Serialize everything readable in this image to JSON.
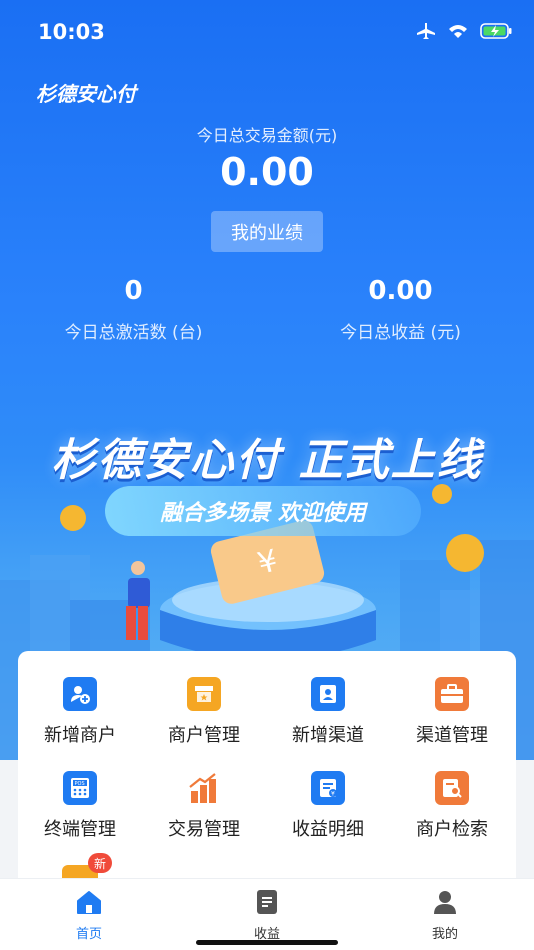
{
  "status_bar": {
    "time": "10:03"
  },
  "app": {
    "title": "杉德安心付"
  },
  "today_total": {
    "label": "今日总交易金额(元)",
    "value": "0.00"
  },
  "performance_button": "我的业绩",
  "stats": [
    {
      "value": "0",
      "label": "今日总激活数 (台)"
    },
    {
      "value": "0.00",
      "label": "今日总收益 (元)"
    }
  ],
  "banner": {
    "title": "杉德安心付 正式上线",
    "subtitle": "融合多场景 欢迎使用"
  },
  "grid": [
    {
      "label": "新增商户",
      "icon": "add-merchant-icon",
      "color": "#1f7bf2"
    },
    {
      "label": "商户管理",
      "icon": "store-icon",
      "color": "#f5a623"
    },
    {
      "label": "新增渠道",
      "icon": "add-channel-icon",
      "color": "#1f7bf2"
    },
    {
      "label": "渠道管理",
      "icon": "briefcase-icon",
      "color": "#f07a3a"
    },
    {
      "label": "终端管理",
      "icon": "pos-terminal-icon",
      "color": "#1f7bf2"
    },
    {
      "label": "交易管理",
      "icon": "bar-chart-icon",
      "color": "#f07a3a"
    },
    {
      "label": "收益明细",
      "icon": "income-detail-icon",
      "color": "#1f7bf2"
    },
    {
      "label": "商户检索",
      "icon": "search-merchant-icon",
      "color": "#f07a3a"
    }
  ],
  "new_badge": "新",
  "tabs": [
    {
      "label": "首页",
      "icon": "home-icon",
      "active": true
    },
    {
      "label": "收益",
      "icon": "document-icon",
      "active": false
    },
    {
      "label": "我的",
      "icon": "user-icon",
      "active": false
    }
  ],
  "colors": {
    "primary": "#1f7bf2",
    "accent_orange": "#f07a3a",
    "badge_red": "#f04b3a"
  }
}
